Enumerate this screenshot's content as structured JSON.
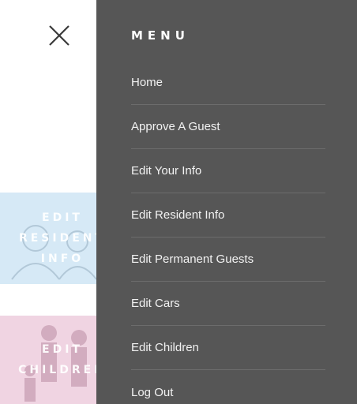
{
  "menu": {
    "heading": "MENU",
    "items": [
      {
        "label": "Home"
      },
      {
        "label": "Approve A Guest"
      },
      {
        "label": "Edit Your Info"
      },
      {
        "label": "Edit Resident Info"
      },
      {
        "label": "Edit Permanent Guests"
      },
      {
        "label": "Edit Cars"
      },
      {
        "label": "Edit Children"
      },
      {
        "label": "Log Out"
      }
    ]
  },
  "tiles": {
    "resident": {
      "label": "EDIT\nRESIDENT\nINFO",
      "color": "#d6e9f6"
    },
    "children": {
      "label": "EDIT\nCHILDREN",
      "color": "#f0d4e2"
    }
  },
  "colors": {
    "menu_bg": "#565656",
    "close_icon": "#3a3a3a"
  },
  "icons": {
    "close": "close-icon"
  }
}
